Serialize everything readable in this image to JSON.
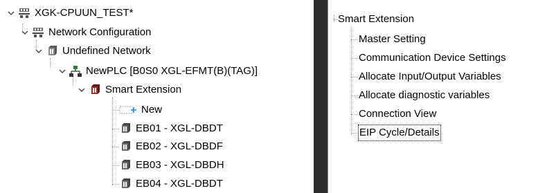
{
  "project_tree": {
    "project": {
      "label": "XGK-CPUUN_TEST*",
      "icon": "project-network-icon",
      "expanded": true
    },
    "network_config": {
      "label": "Network Configuration",
      "icon": "network-config-icon",
      "expanded": true
    },
    "undefined_network": {
      "label": "Undefined Network",
      "icon": "network-module-icon",
      "expanded": true
    },
    "plc": {
      "label": "NewPLC [B0S0 XGL-EFMT(B)(TAG)]",
      "icon": "plc-network-icon",
      "expanded": true
    },
    "smart_extension": {
      "label": "Smart Extension",
      "icon": "smart-extension-icon",
      "expanded": true
    },
    "items": [
      {
        "label": "New",
        "icon": "new-item-icon"
      },
      {
        "label": "EB01 - XGL-DBDT",
        "icon": "module-icon"
      },
      {
        "label": "EB02 - XGL-DBDF",
        "icon": "module-icon"
      },
      {
        "label": "EB03 - XGL-DBDH",
        "icon": "module-icon"
      },
      {
        "label": "EB04 - XGL-DBDT",
        "icon": "module-icon"
      }
    ]
  },
  "settings_tree": {
    "root": "Smart Extension",
    "items": [
      {
        "label": "Master Setting"
      },
      {
        "label": "Communication Device Settings"
      },
      {
        "label": "Allocate Input/Output Variables"
      },
      {
        "label": "Allocate diagnostic variables"
      },
      {
        "label": "Connection View"
      },
      {
        "label": "EIP Cycle/Details",
        "selected": true
      }
    ]
  },
  "colors": {
    "splitter": "#2d2d30",
    "tree_line": "#9a9a9a",
    "module_icon": "#8b2e2e",
    "plc_icon": "#2e7d32"
  }
}
